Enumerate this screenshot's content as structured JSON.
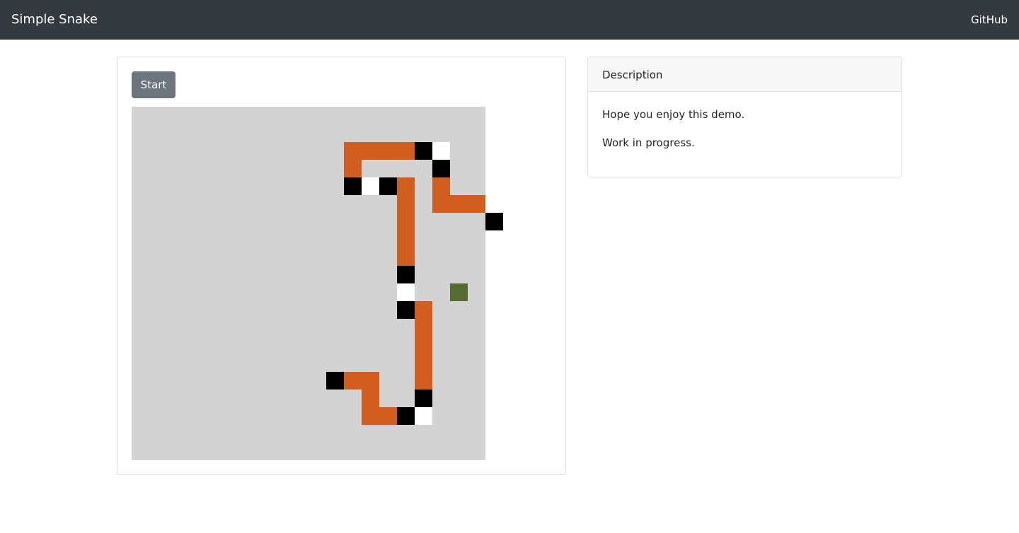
{
  "navbar": {
    "brand": "Simple Snake",
    "link": "GitHub"
  },
  "controls": {
    "start_label": "Start"
  },
  "description": {
    "header": "Description",
    "lines": [
      "Hope you enjoy this demo.",
      "Work in progress."
    ]
  },
  "board": {
    "grid_size": [
      20,
      20
    ],
    "colors": {
      "background": "#d3d3d3",
      "snake": "#d15e1e",
      "black": "#000000",
      "white": "#ffffff",
      "food": "#556b2f"
    },
    "snake_cells": [
      [
        12,
        2
      ],
      [
        13,
        2
      ],
      [
        14,
        2
      ],
      [
        15,
        2
      ],
      [
        12,
        3
      ],
      [
        15,
        4
      ],
      [
        17,
        4
      ],
      [
        15,
        5
      ],
      [
        17,
        5
      ],
      [
        18,
        5
      ],
      [
        19,
        5
      ],
      [
        15,
        6
      ],
      [
        15,
        7
      ],
      [
        15,
        8
      ],
      [
        16,
        11
      ],
      [
        16,
        12
      ],
      [
        16,
        13
      ],
      [
        16,
        14
      ],
      [
        16,
        15
      ],
      [
        12,
        15
      ],
      [
        13,
        15
      ],
      [
        13,
        16
      ],
      [
        13,
        17
      ],
      [
        14,
        17
      ]
    ],
    "black_cells": [
      [
        16,
        2
      ],
      [
        17,
        3
      ],
      [
        12,
        4
      ],
      [
        14,
        4
      ],
      [
        20,
        6
      ],
      [
        15,
        9
      ],
      [
        15,
        11
      ],
      [
        11,
        15
      ],
      [
        16,
        16
      ],
      [
        15,
        17
      ]
    ],
    "white_cells": [
      [
        17,
        2
      ],
      [
        13,
        4
      ],
      [
        15,
        10
      ],
      [
        16,
        17
      ]
    ],
    "food": [
      18,
      10
    ]
  }
}
